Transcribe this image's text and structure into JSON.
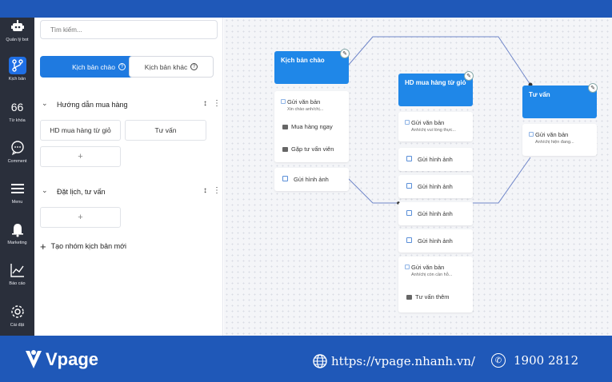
{
  "sidebar": {
    "items": [
      {
        "label": "Quản lý bot",
        "icon": "bot-icon",
        "active": false
      },
      {
        "label": "Kịch bản",
        "icon": "flow-icon",
        "active": true
      },
      {
        "label": "Từ khóa",
        "icon": "keyword-icon",
        "glyph": "66",
        "active": false
      },
      {
        "label": "Comment",
        "icon": "comment-icon",
        "active": false
      },
      {
        "label": "Menu",
        "icon": "menu-icon",
        "active": false
      },
      {
        "label": "Marketing",
        "icon": "bell-icon",
        "active": false
      },
      {
        "label": "Báo cáo",
        "icon": "chart-icon",
        "active": false
      },
      {
        "label": "Cài đặt",
        "icon": "gear-icon",
        "active": false
      }
    ]
  },
  "panel": {
    "search_placeholder": "Tìm kiếm...",
    "tabs": [
      {
        "label": "Kịch bản chào",
        "active": true
      },
      {
        "label": "Kịch bản khác",
        "active": false
      }
    ],
    "groups": [
      {
        "title": "Hướng dẫn mua hàng",
        "chips": [
          "HD mua hàng từ giỏ",
          "Tư vấn"
        ],
        "add": "+"
      },
      {
        "title": "Đặt lịch, tư vấn",
        "chips": [],
        "add": "+"
      }
    ],
    "new_group": "Tạo nhóm kịch bản mới"
  },
  "canvas": {
    "node1": {
      "title": "Kịch bản chào",
      "text_title": "Gửi văn bản",
      "text_sub": "Xin chào anh/chị...",
      "buttons": [
        "Mua hàng ngay",
        "Gặp tư vấn viên"
      ],
      "image": "Gửi hình ảnh"
    },
    "node2": {
      "title": "HD mua hàng từ giỏ",
      "text_title": "Gửi văn bản",
      "text_sub": "Anh/chị vui lòng thực...",
      "images": [
        "Gửi hình ảnh",
        "Gửi hình ảnh",
        "Gửi hình ảnh",
        "Gửi hình ảnh"
      ],
      "text2_title": "Gửi văn bản",
      "text2_sub": "Anh/chị còn cần hỗ...",
      "button": "Tư vấn thêm"
    },
    "node3": {
      "title": "Tư vấn",
      "text_title": "Gửi văn bản",
      "text_sub": "Anh/chị hiện đang..."
    }
  },
  "footer": {
    "brand": "Vpage",
    "url": "https://vpage.nhanh.vn/",
    "phone": "1900 2812"
  },
  "colors": {
    "topbar": "#1f58b8",
    "sidebar": "#2a2f3b",
    "accent": "#1f7ae0",
    "node_header": "#1f87e8",
    "connector": "#6f86c9"
  }
}
